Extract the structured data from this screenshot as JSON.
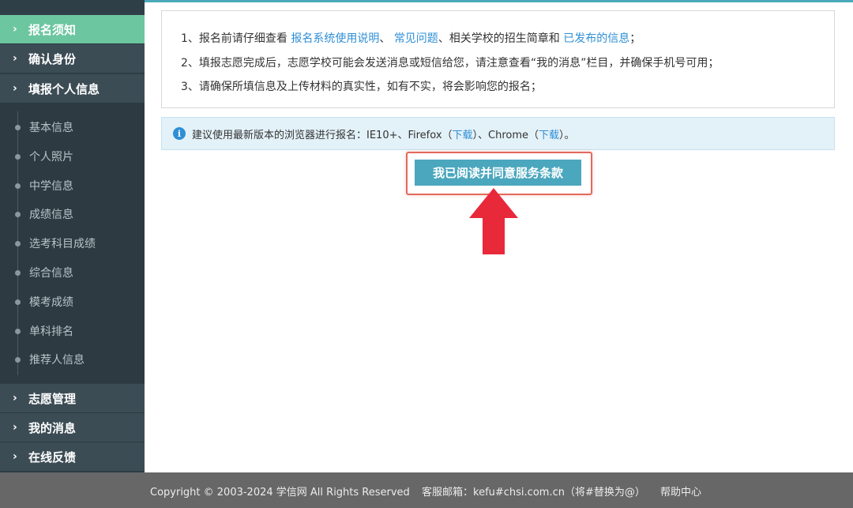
{
  "sidebar": {
    "main_items": [
      {
        "label": "报名须知",
        "active": true
      },
      {
        "label": "确认身份",
        "active": false
      },
      {
        "label": "填报个人信息",
        "active": false
      }
    ],
    "sub_items": [
      {
        "label": "基本信息"
      },
      {
        "label": "个人照片"
      },
      {
        "label": "中学信息"
      },
      {
        "label": "成绩信息"
      },
      {
        "label": "选考科目成绩"
      },
      {
        "label": "综合信息"
      },
      {
        "label": "模考成绩"
      },
      {
        "label": "单科排名"
      },
      {
        "label": "推荐人信息"
      }
    ],
    "bottom_items": [
      {
        "label": "志愿管理"
      },
      {
        "label": "我的消息"
      },
      {
        "label": "在线反馈"
      }
    ],
    "chevron": "›"
  },
  "notice": {
    "line1": {
      "prefix": "1、报名前请仔细查看 ",
      "link1": "报名系统使用说明",
      "sep1": "、 ",
      "link2": "常见问题",
      "mid": "、相关学校的招生简章和 ",
      "link3": "已发布的信息",
      "suffix": "；"
    },
    "line2": "2、填报志愿完成后，志愿学校可能会发送消息或短信给您，请注意查看“我的消息”栏目，并确保手机号可用；",
    "line3": "3、请确保所填信息及上传材料的真实性，如有不实，将会影响您的报名；"
  },
  "tip": {
    "icon": "info-icon",
    "text1": "建议使用最新版本的浏览器进行报名：IE10+、Firefox（",
    "link1": "下载",
    "text2": "）、Chrome（",
    "link2": "下载",
    "text3": "）。"
  },
  "agree_button": {
    "label": "我已阅读并同意服务条款"
  },
  "footer": {
    "copyright": "Copyright © 2003-2024 学信网 All Rights Reserved",
    "email": "客服邮箱：kefu#chsi.com.cn（将#替换为@）",
    "help": "帮助中心"
  },
  "colors": {
    "sidebar_bg": "#2f3f48",
    "active_item": "#6cc6a0",
    "button": "#4ba7bd",
    "link": "#2e8fd6",
    "annotation": "#e8293a"
  }
}
